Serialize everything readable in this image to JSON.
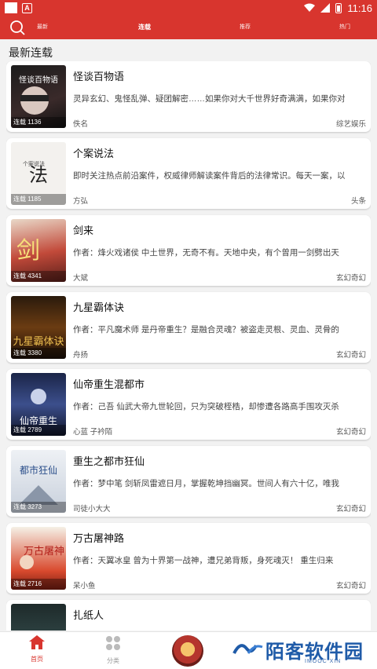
{
  "status_bar": {
    "time": "11:16"
  },
  "header": {
    "tabs": [
      {
        "label": "最新"
      },
      {
        "label": "连载"
      },
      {
        "label": "推荐"
      },
      {
        "label": "热门"
      }
    ]
  },
  "section_title": "最新连载",
  "books": [
    {
      "title": "怪谈百物语",
      "desc": "灵异玄幻、鬼怪乱弹、疑团解密……如果你对大千世界好奇满满，如果你对",
      "author": "佚名",
      "category": "综艺娱乐",
      "tag": "连载 1136",
      "cover_text": "怪谈百物语"
    },
    {
      "title": "个案说法",
      "desc": "即时关注热点前沿案件，权威律师解读案件背后的法律常识。每天一案，以",
      "author": "方弘",
      "category": "头条",
      "tag": "连载 1185",
      "cover_text": "个案说法"
    },
    {
      "title": "剑来",
      "desc": "作者：烽火戏诸侯 中土世界，无奇不有。天地中央，有个曾用一剑劈出天",
      "author": "大斌",
      "category": "玄幻奇幻",
      "tag": "连载 4341",
      "cover_text": "剑"
    },
    {
      "title": "九星霸体诀",
      "desc": "作者：平凡魔术师 是丹帝重生？是融合灵魂？被盗走灵根、灵血、灵骨的",
      "author": "舟扬",
      "category": "玄幻奇幻",
      "tag": "连载 3380",
      "cover_text": "九星霸体诀"
    },
    {
      "title": "仙帝重生混都市",
      "desc": "作者：己吾 仙武大帝九世轮回，只为突破桎梏，却惨遭各路高手围攻灭杀",
      "author": "心蓝 子衿陌",
      "category": "玄幻奇幻",
      "tag": "连载 2789",
      "cover_text": "仙帝重生"
    },
    {
      "title": "重生之都市狂仙",
      "desc": "作者：梦中笔 剑斩凤雷遮日月，掌握乾坤挡幽冥。世间人有六十亿，唯我",
      "author": "司徒小大大",
      "category": "玄幻奇幻",
      "tag": "连载 3273",
      "cover_text": "都市狂仙"
    },
    {
      "title": "万古屠神路",
      "desc": "作者：天翼冰皇 曾为十界第一战神，遭兄弟背叛，身死魂灭！ 重生归来",
      "author": "呆小鱼",
      "category": "玄幻奇幻",
      "tag": "连载 2716",
      "cover_text": "万古屠神"
    },
    {
      "title": "扎纸人",
      "desc": "",
      "author": "",
      "category": "",
      "tag": "",
      "cover_text": ""
    }
  ],
  "bottom_nav": {
    "home_label": "首页",
    "category_label": "分类"
  },
  "watermark": {
    "text": "陌客软件园",
    "sub": "IMOOC XIN"
  },
  "colors": {
    "accent": "#d8352e",
    "watermark": "#1f5ba8"
  }
}
